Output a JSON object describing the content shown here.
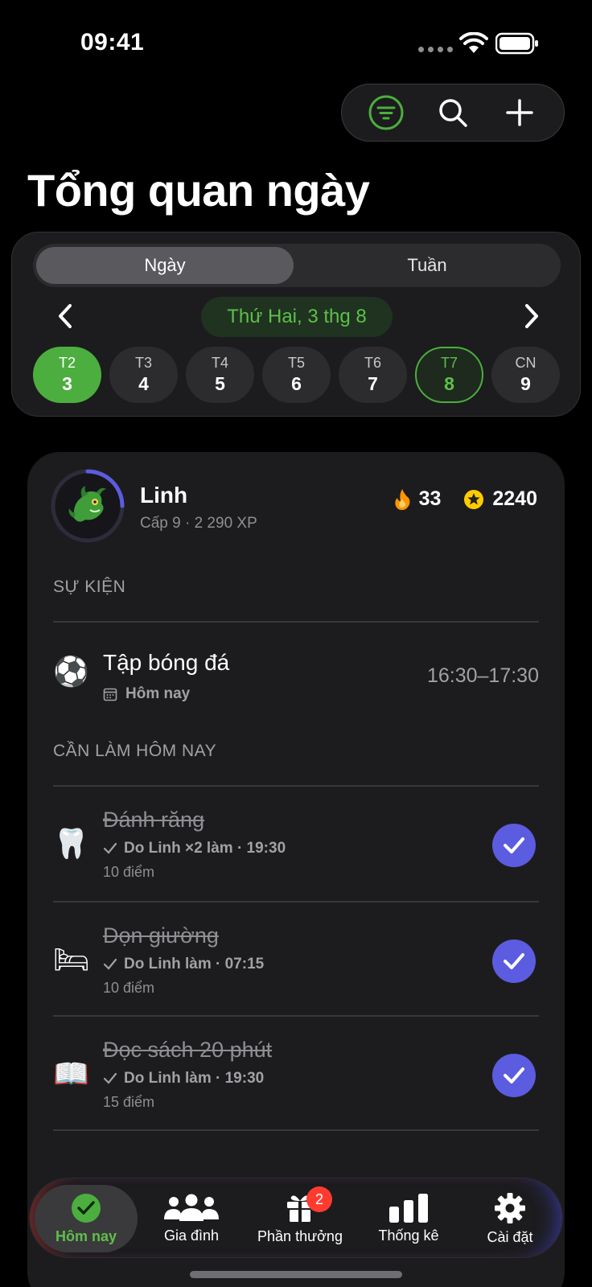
{
  "status_bar": {
    "time": "09:41"
  },
  "header": {
    "title": "Tổng quan ngày",
    "actions": [
      "filter-icon",
      "search-icon",
      "plus-icon"
    ]
  },
  "view_toggle": {
    "options": [
      "Ngày",
      "Tuần"
    ],
    "selected": "Ngày"
  },
  "date_nav": {
    "current_label": "Thứ Hai, 3 thg 8",
    "days": [
      {
        "name": "T2",
        "num": "3"
      },
      {
        "name": "T3",
        "num": "4"
      },
      {
        "name": "T4",
        "num": "5"
      },
      {
        "name": "T5",
        "num": "6"
      },
      {
        "name": "T6",
        "num": "7"
      },
      {
        "name": "T7",
        "num": "8"
      },
      {
        "name": "CN",
        "num": "9"
      }
    ],
    "selected_index": 0,
    "today_index": 5
  },
  "profile": {
    "name": "Linh",
    "subtitle": "Cấp 9 · 2 290 XP",
    "level_progress": 0.25,
    "streak": "33",
    "stars": "2240"
  },
  "events": {
    "section_label": "SỰ KIỆN",
    "items": [
      {
        "emoji": "⚽",
        "title": "Tập bóng đá",
        "date": "Hôm nay",
        "time": "16:30–17:30"
      }
    ]
  },
  "tasks": {
    "section_label": "CẦN LÀM HÔM NAY",
    "items": [
      {
        "emoji": "🦷",
        "title": "Đánh răng",
        "meta": "Do Linh ×2 làm · 19:30",
        "points": "10 điểm",
        "done": true
      },
      {
        "emoji": "🛏",
        "title": "Dọn giường",
        "meta": "Do Linh làm · 07:15",
        "points": "10 điểm",
        "done": true
      },
      {
        "emoji": "📖",
        "title": "Đọc sách 20 phút",
        "meta": "Do Linh làm · 19:30",
        "points": "15 điểm",
        "done": true
      }
    ]
  },
  "tab_bar": {
    "items": [
      {
        "label": "Hôm nay",
        "icon": "check-circle-icon",
        "active": true
      },
      {
        "label": "Gia đình",
        "icon": "people-icon"
      },
      {
        "label": "Phần thưởng",
        "icon": "gift-icon",
        "badge": "2"
      },
      {
        "label": "Thống kê",
        "icon": "bar-chart-icon"
      },
      {
        "label": "Cài đặt",
        "icon": "gear-icon"
      }
    ]
  },
  "colors": {
    "accent_green": "#4cae3e",
    "check_purple": "#5b5ce0",
    "badge_red": "#ff3b30",
    "star_yellow": "#ffcc00",
    "flame_orange": "#ff9500"
  }
}
